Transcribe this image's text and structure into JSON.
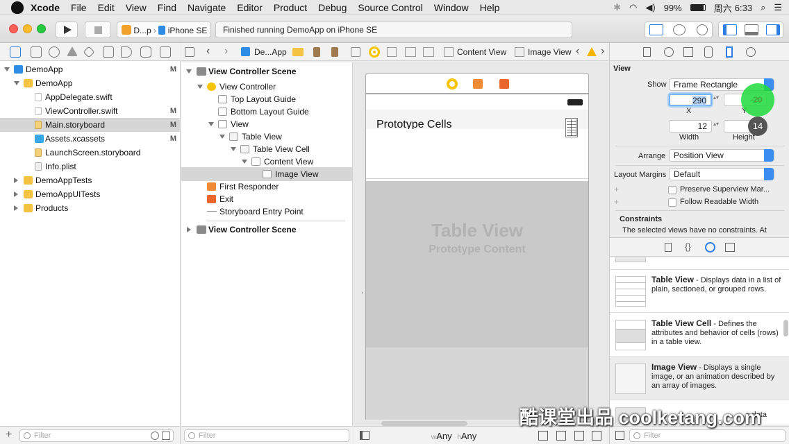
{
  "menubar": {
    "app": "Xcode",
    "items": [
      "File",
      "Edit",
      "View",
      "Find",
      "Navigate",
      "Editor",
      "Product",
      "Debug",
      "Source Control",
      "Window",
      "Help"
    ],
    "battery": "99%",
    "day": "周六",
    "time": "6:33"
  },
  "toolbar": {
    "scheme": "D...p",
    "device": "iPhone SE",
    "status": "Finished running DemoApp on iPhone SE"
  },
  "navigator": {
    "items": [
      {
        "label": "DemoApp",
        "badge": "M"
      },
      {
        "label": "DemoApp",
        "badge": ""
      },
      {
        "label": "AppDelegate.swift",
        "badge": ""
      },
      {
        "label": "ViewController.swift",
        "badge": "M"
      },
      {
        "label": "Main.storyboard",
        "badge": "M"
      },
      {
        "label": "Assets.xcassets",
        "badge": "M"
      },
      {
        "label": "LaunchScreen.storyboard",
        "badge": ""
      },
      {
        "label": "Info.plist",
        "badge": ""
      },
      {
        "label": "DemoAppTests",
        "badge": ""
      },
      {
        "label": "DemoAppUITests",
        "badge": ""
      },
      {
        "label": "Products",
        "badge": ""
      }
    ],
    "filter_placeholder": "Filter"
  },
  "jumpbar": {
    "crumbs": [
      "De...App",
      "Content View",
      "Image View"
    ]
  },
  "outline": {
    "items": [
      "View Controller Scene",
      "View Controller",
      "Top Layout Guide",
      "Bottom Layout Guide",
      "View",
      "Table View",
      "Table View Cell",
      "Content View",
      "Image View",
      "First Responder",
      "Exit",
      "Storyboard Entry Point",
      "View Controller Scene"
    ],
    "filter_placeholder": "Filter"
  },
  "canvas": {
    "header": "Prototype Cells",
    "table_title": "Table View",
    "table_sub": "Prototype Content",
    "size_w_prefix": "w",
    "size_w": "Any",
    "size_h_prefix": "h",
    "size_h": "Any"
  },
  "inspector": {
    "section": "View",
    "show_label": "Show",
    "show_value": "Frame Rectangle",
    "x_value": "290",
    "y_value": "-20",
    "x_label": "X",
    "y_label": "Y",
    "width_value": "12",
    "height_value": "14",
    "width_label": "Width",
    "height_label": "Height",
    "arrange_label": "Arrange",
    "arrange_value": "Position View",
    "margins_label": "Layout Margins",
    "margins_value": "Default",
    "chk1": "Preserve Superview Mar...",
    "chk2": "Follow Readable Width",
    "constraints_title": "Constraints",
    "constraints_text": "The selected views have no constraints. At",
    "library": [
      {
        "name": "Table View",
        "desc": " - Displays data in a list of plain, sectioned, or grouped rows."
      },
      {
        "name": "Table View Cell",
        "desc": " - Defines the attributes and behavior of cells (rows) in a table view."
      },
      {
        "name": "Image View",
        "desc": " - Displays a single image, or an animation described by an array of images."
      }
    ],
    "partial_text": "s data",
    "filter_placeholder": "Filter"
  },
  "watermark": "酷课堂出品 coolketang.com"
}
